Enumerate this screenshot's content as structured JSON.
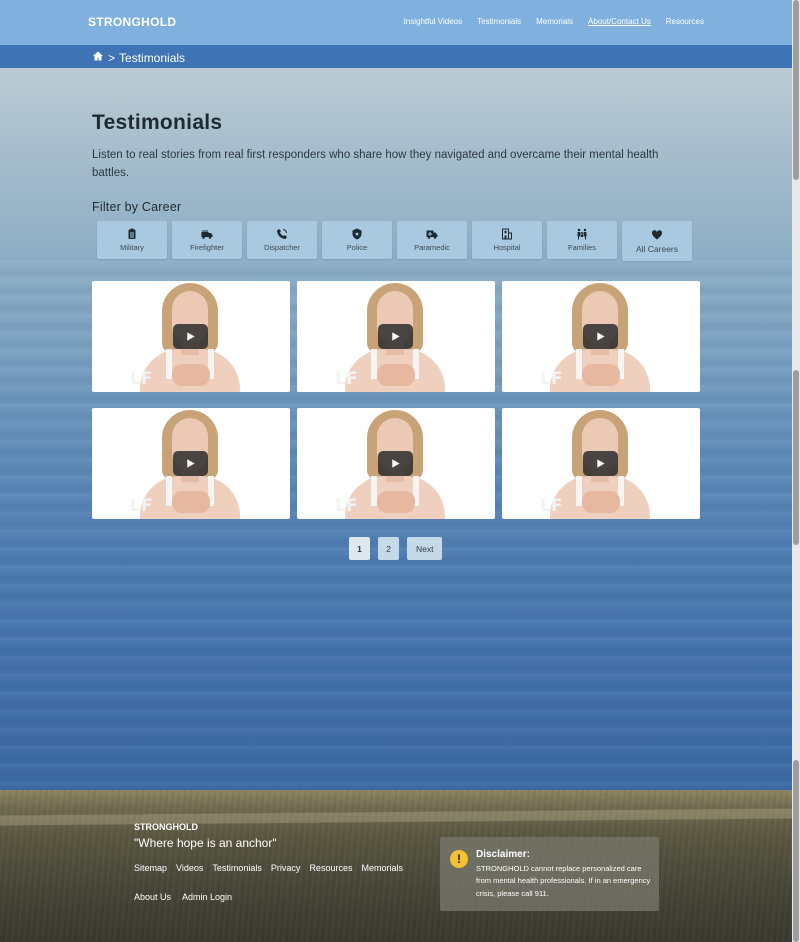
{
  "header": {
    "brand": "STRONGHOLD",
    "nav": [
      {
        "label": "Insightful Videos"
      },
      {
        "label": "Testimonials"
      },
      {
        "label": "Memorials"
      },
      {
        "label": "About/Contact Us"
      },
      {
        "label": "Resources"
      }
    ]
  },
  "breadcrumb": {
    "home_icon": "home-icon",
    "separator": ">",
    "current": "Testimonials"
  },
  "main": {
    "title": "Testimonials",
    "intro": "Listen to real stories from real first responders who share how they navigated and overcame their mental health battles.",
    "filter_title": "Filter by Career",
    "filters": [
      {
        "label": "Military",
        "icon": "clipboard-icon"
      },
      {
        "label": "Firefighter",
        "icon": "fire-truck-icon"
      },
      {
        "label": "Dispatcher",
        "icon": "phone-icon"
      },
      {
        "label": "Police",
        "icon": "shield-icon"
      },
      {
        "label": "Paramedic",
        "icon": "ambulance-icon"
      },
      {
        "label": "Hospital",
        "icon": "hospital-icon"
      },
      {
        "label": "Families",
        "icon": "family-icon"
      },
      {
        "label": "All Careers",
        "icon": "heart-icon"
      }
    ],
    "videos": [
      {
        "watermark": "LF"
      },
      {
        "watermark": "LF"
      },
      {
        "watermark": "LF"
      },
      {
        "watermark": "LF"
      },
      {
        "watermark": "LF"
      },
      {
        "watermark": "LF"
      }
    ],
    "pagination": {
      "pages": [
        "1",
        "2"
      ],
      "current": "1",
      "next_label": "Next"
    }
  },
  "footer": {
    "brand": "STRONGHOLD",
    "tagline": "\"Where hope is an anchor\"",
    "links_row1": [
      "Sitemap",
      "Videos",
      "Testimonials",
      "Privacy",
      "Resources",
      "Memorials"
    ],
    "links_row2": [
      "About Us",
      "Admin Login"
    ],
    "disclaimer": {
      "icon": "!",
      "title": "Disclaimer:",
      "text": "STRONGHOLD cannot replace personalized care from mental health professionals. If in an emergency crisis, please call 911."
    }
  },
  "colors": {
    "topnav": "#7fb0de",
    "crumbbar": "#3e73b6",
    "filter_bg": "#a8c9df",
    "warn": "#f2c230"
  }
}
